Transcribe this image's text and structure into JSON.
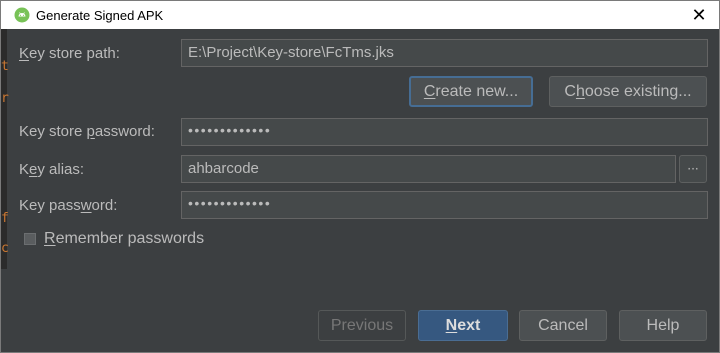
{
  "window": {
    "title": "Generate Signed APK",
    "close_glyph": "✕",
    "icon": "android-studio-icon"
  },
  "background_editor": {
    "chars": [
      "t",
      "r",
      "f",
      "c"
    ],
    "color": "#cc7832"
  },
  "form": {
    "key_store_path": {
      "label_pre": "",
      "label_mnemonic": "K",
      "label_post": "ey store path:",
      "value": "E:\\Project\\Key-store\\FcTms.jks"
    },
    "create_new": {
      "pre": "",
      "mnemonic": "C",
      "post": "reate new..."
    },
    "choose_existing": {
      "pre": "C",
      "mnemonic": "h",
      "post": "oose existing..."
    },
    "key_store_password": {
      "label_pre": "Key store ",
      "label_mnemonic": "p",
      "label_post": "assword:",
      "value": "•••••••••••••"
    },
    "key_alias": {
      "label_pre": "K",
      "label_mnemonic": "e",
      "label_post": "y alias:",
      "value": "ahbarcode",
      "browse_glyph": "···"
    },
    "key_password": {
      "label_pre": "Key pass",
      "label_mnemonic": "w",
      "label_post": "ord:",
      "value": "•••••••••••••"
    },
    "remember": {
      "pre": "",
      "mnemonic": "R",
      "post": "emember passwords",
      "checked": false
    }
  },
  "footer": {
    "previous": "Previous",
    "next_mnemonic": "N",
    "next_post": "ext",
    "cancel": "Cancel",
    "help": "Help"
  },
  "colors": {
    "dialog_bg": "#3c3f41",
    "field_bg": "#45494a",
    "text": "#bbbbbb",
    "default_button": "#365880",
    "focus_ring": "#466d94"
  }
}
